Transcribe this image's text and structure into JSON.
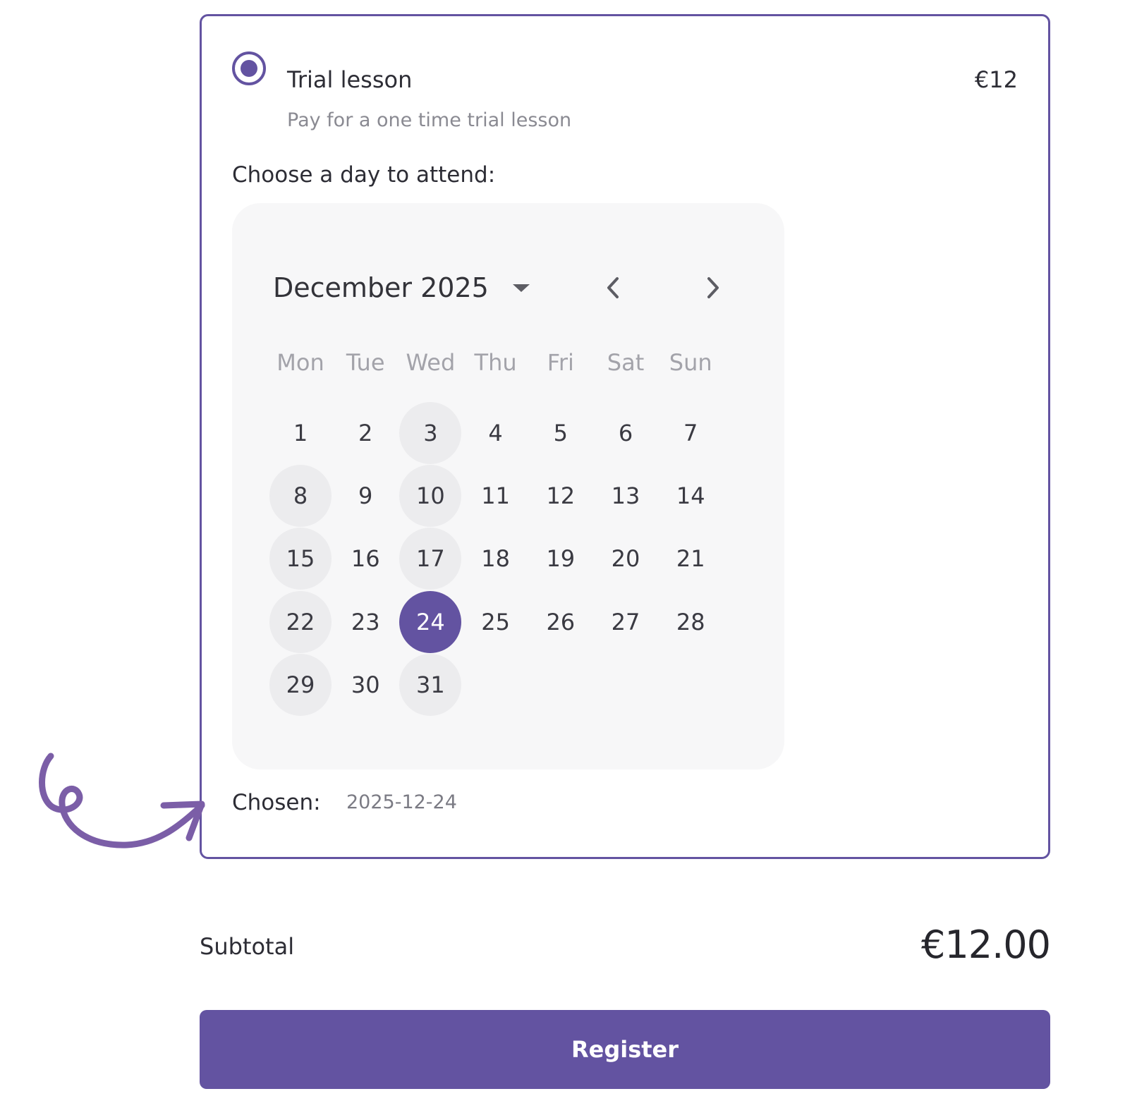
{
  "option": {
    "title": "Trial lesson",
    "price": "€12",
    "description": "Pay for a one time trial lesson",
    "selected": true
  },
  "choose_label": "Choose a day to attend:",
  "calendar": {
    "month_label": "December 2025",
    "weekdays": [
      "Mon",
      "Tue",
      "Wed",
      "Thu",
      "Fri",
      "Sat",
      "Sun"
    ],
    "first_weekday_index": 0,
    "days_in_month": 31,
    "available_days": [
      3,
      8,
      10,
      15,
      17,
      22,
      24,
      29,
      31
    ],
    "selected_day": 24
  },
  "chosen": {
    "label": "Chosen:",
    "value": "2025-12-24"
  },
  "subtotal": {
    "label": "Subtotal",
    "value": "€12.00"
  },
  "register_label": "Register",
  "colors": {
    "accent": "#6353a1",
    "calendar_bg": "#f7f7f8",
    "available_day_bg": "#ececee"
  },
  "icons": {
    "radio": "radio-selected-icon",
    "month_dropdown": "caret-down-icon",
    "prev": "chevron-left-icon",
    "next": "chevron-right-icon",
    "annotation": "curly-arrow-icon"
  }
}
